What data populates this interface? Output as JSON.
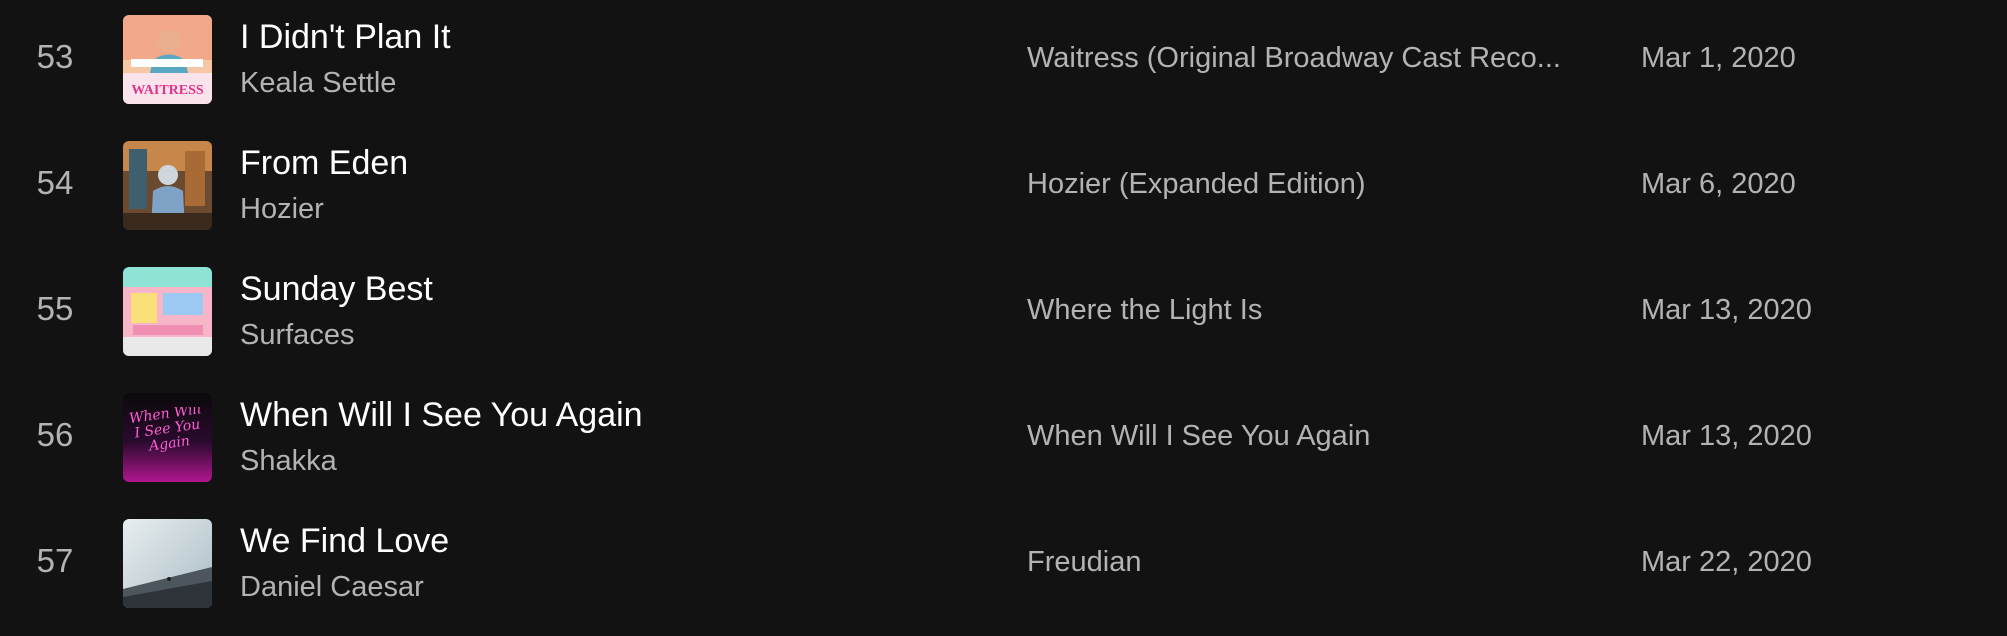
{
  "tracks": [
    {
      "number": "53",
      "title": "I Didn't Plan It",
      "artist": "Keala Settle",
      "album": "Waitress (Original Broadway Cast Reco...",
      "date_added": "Mar 1, 2020",
      "art_text": "WAITRESS"
    },
    {
      "number": "54",
      "title": "From Eden",
      "artist": "Hozier",
      "album": "Hozier (Expanded Edition)",
      "date_added": "Mar 6, 2020"
    },
    {
      "number": "55",
      "title": "Sunday Best",
      "artist": "Surfaces",
      "album": "Where the Light Is",
      "date_added": "Mar 13, 2020"
    },
    {
      "number": "56",
      "title": "When Will I See You Again",
      "artist": "Shakka",
      "album": "When Will I See You Again",
      "date_added": "Mar 13, 2020",
      "art_text": "When Will I See You Again"
    },
    {
      "number": "57",
      "title": "We Find Love",
      "artist": "Daniel Caesar",
      "album": "Freudian",
      "date_added": "Mar 22, 2020"
    }
  ],
  "colors": {
    "background": "#121212",
    "primary_text": "#ffffff",
    "secondary_text": "#b3b3b3"
  }
}
